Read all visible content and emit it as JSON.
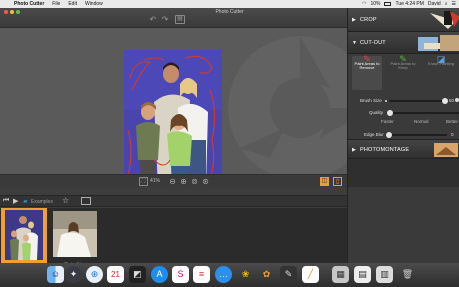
{
  "menubar": {
    "app_name": "Photo Cutter",
    "items": [
      "File",
      "Edit",
      "Window"
    ],
    "battery": "10%",
    "clock": "Tue 4:24 PM",
    "user": "David"
  },
  "window": {
    "title": "Photo Cutter"
  },
  "toolbar": {
    "zoom_level": "41%"
  },
  "panel": {
    "crop_label": "CROP",
    "cutout_label": "CUT-OUT",
    "tools": [
      {
        "label": "Paint Areas to Remove",
        "icon": "red-pen-icon",
        "color": "#e0463d"
      },
      {
        "label": "Paint Areas to Keep",
        "icon": "green-pen-icon",
        "color": "#5bb13b"
      },
      {
        "label": "Erase Painting",
        "icon": "eraser-icon",
        "color": "#5a9de0"
      }
    ],
    "brush_size_label": "Brush Size",
    "brush_size_value": "50",
    "brush_size_fraction": 0.97,
    "quality_label": "Quality",
    "quality_options": [
      "Faster",
      "Normal",
      "Better"
    ],
    "quality_fraction": 0.02,
    "edge_blur_label": "Edge Blur",
    "edge_blur_value": "0",
    "edge_blur_fraction": 0.0,
    "photomontage_label": "PHOTOMONTAGE"
  },
  "browser": {
    "folder_label": "Examples",
    "thumbnails": [
      {
        "label": "Photo_1.jpg",
        "selected": true
      },
      {
        "label": "Photo_2.jpg",
        "selected": false
      }
    ]
  },
  "colors": {
    "accent_orange": "#f0a032",
    "scribble_red": "#cc3a30",
    "mask_blue": "#4c48b8"
  }
}
